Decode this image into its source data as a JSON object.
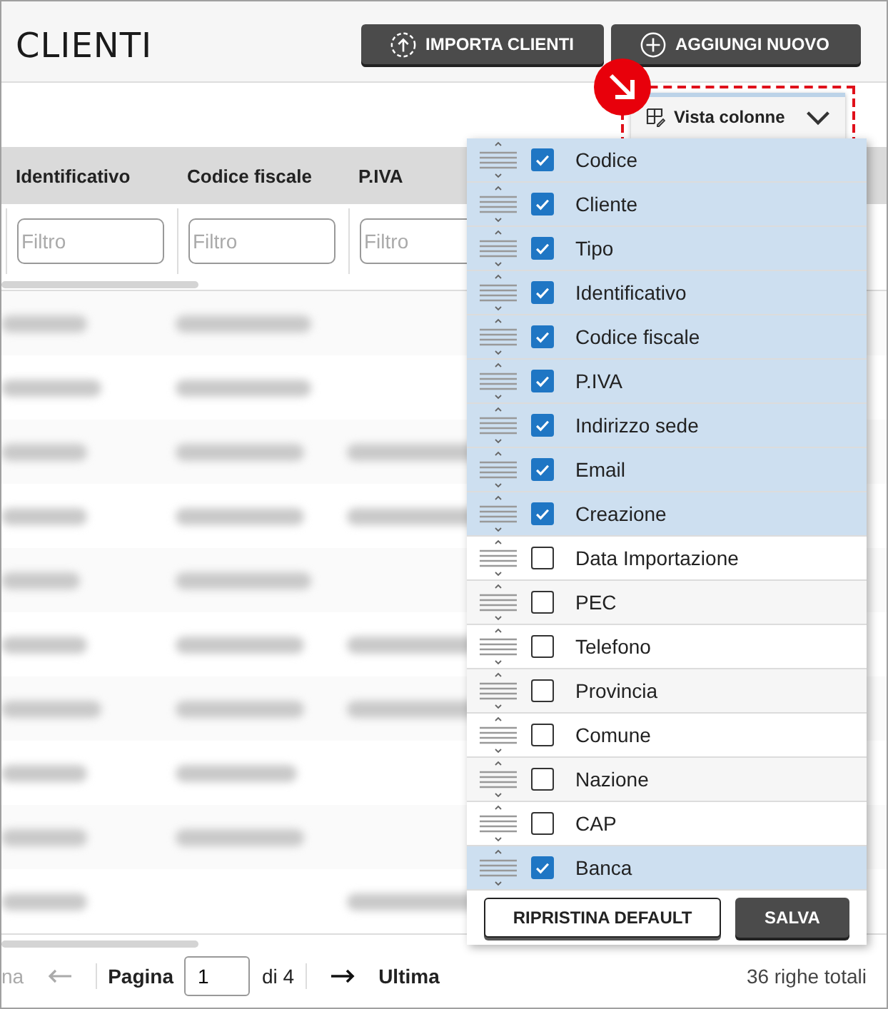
{
  "page": {
    "title": "CLIENTI"
  },
  "actions": [
    {
      "label": "IMPORTA CLIENTI",
      "kind": "import"
    },
    {
      "label": "AGGIUNGI NUOVO",
      "kind": "add"
    }
  ],
  "column_view": {
    "label": "Vista colonne",
    "expanded": true,
    "highlighted": true
  },
  "table": {
    "columns": [
      {
        "label": "Identificativo",
        "filter_placeholder": "Filtro"
      },
      {
        "label": "Codice fiscale",
        "filter_placeholder": "Filtro"
      },
      {
        "label": "P.IVA",
        "filter_placeholder": "Filtro"
      }
    ]
  },
  "pagination": {
    "first_label": "na",
    "previous_disabled": true,
    "page_label": "Pagina",
    "page_value": "1",
    "of_total": "di 4",
    "last_label": "Ultima",
    "total": "36 righe totali"
  },
  "column_menu": {
    "items": [
      {
        "label": "Codice",
        "checked": true
      },
      {
        "label": "Cliente",
        "checked": true
      },
      {
        "label": "Tipo",
        "checked": true
      },
      {
        "label": "Identificativo",
        "checked": true
      },
      {
        "label": "Codice fiscale",
        "checked": true
      },
      {
        "label": "P.IVA",
        "checked": true
      },
      {
        "label": "Indirizzo sede",
        "checked": true
      },
      {
        "label": "Email",
        "checked": true
      },
      {
        "label": "Creazione",
        "checked": true
      },
      {
        "label": "Data Importazione",
        "checked": false
      },
      {
        "label": "PEC",
        "checked": false
      },
      {
        "label": "Telefono",
        "checked": false
      },
      {
        "label": "Provincia",
        "checked": false
      },
      {
        "label": "Comune",
        "checked": false
      },
      {
        "label": "Nazione",
        "checked": false
      },
      {
        "label": "CAP",
        "checked": false
      },
      {
        "label": "Banca",
        "checked": true
      }
    ],
    "reset_label": "RIPRISTINA DEFAULT",
    "save_label": "SALVA"
  }
}
